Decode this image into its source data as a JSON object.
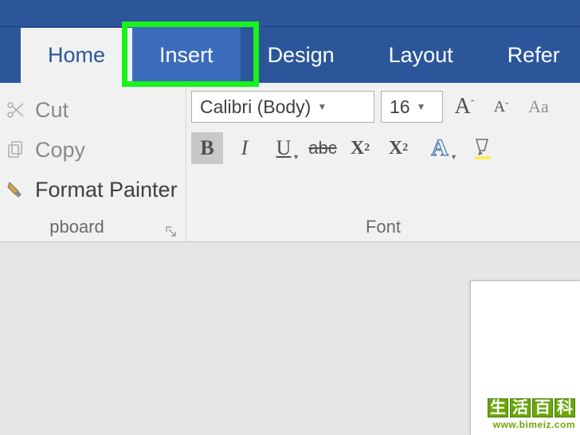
{
  "tabs": {
    "home": "Home",
    "insert": "Insert",
    "design": "Design",
    "layout": "Layout",
    "references_partial": "Refer"
  },
  "clipboard": {
    "cut": "Cut",
    "copy": "Copy",
    "format_painter": "Format Painter",
    "group_label_partial": "pboard"
  },
  "font": {
    "name": "Calibri (Body)",
    "size": "16",
    "group_label": "Font"
  },
  "watermark": {
    "c1": "生",
    "c2": "活",
    "c3": "百",
    "c4": "科",
    "url": "www.bimeiz.com"
  }
}
